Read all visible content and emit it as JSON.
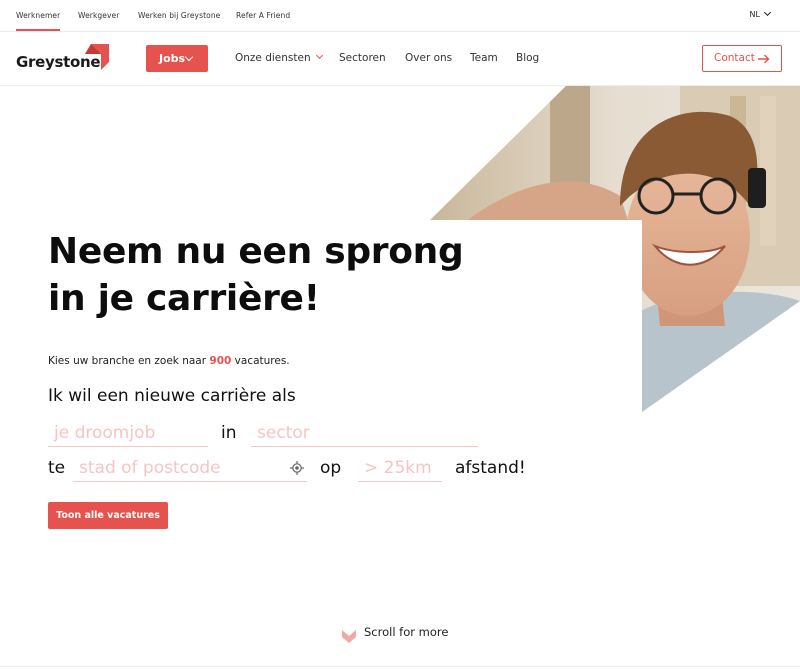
{
  "topbar": {
    "links": [
      {
        "label": "Werknemer",
        "active": true
      },
      {
        "label": "Werkgever",
        "active": false
      },
      {
        "label": "Werken bij Greystone",
        "active": false
      },
      {
        "label": "Refer A Friend",
        "active": false
      }
    ],
    "language": "NL"
  },
  "nav": {
    "logo_text": "Greystone",
    "jobs_label": "Jobs",
    "links": [
      "Onze diensten",
      "Sectoren",
      "Over ons",
      "Team",
      "Blog"
    ],
    "contact_label": "Contact"
  },
  "hero": {
    "headline_line1": "Neem nu een sprong",
    "headline_line2": "in je carrière!",
    "intro_before": "Kies uw branche en zoek naar ",
    "intro_count": "900",
    "intro_after": " vacatures.",
    "lead": "Ik wil een nieuwe carrière als",
    "job_placeholder": "je droomjob",
    "word_in": "in",
    "sector_placeholder": "sector",
    "word_te": "te",
    "city_placeholder": "stad of postcode",
    "word_op": "op",
    "distance_placeholder": "> 25km",
    "word_afstand": "afstand!",
    "button_label": "Toon alle vacatures"
  },
  "scroll_label": "Scroll for more",
  "colors": {
    "accent": "#e6534f",
    "placeholder": "#f6c5c3"
  }
}
